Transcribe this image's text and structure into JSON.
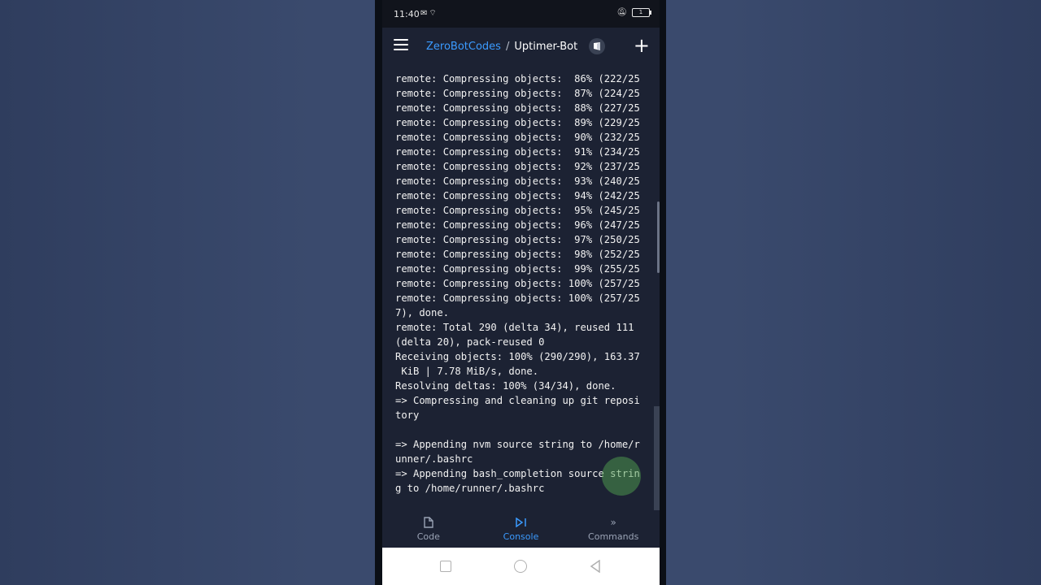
{
  "status_bar": {
    "time": "11:40",
    "battery_level": "1"
  },
  "header": {
    "owner": "ZeroBotCodes",
    "separator": "/",
    "repl_name": "Uptimer-Bot"
  },
  "console": {
    "lines": [
      "remote: Compressing objects:  86% (222/25",
      "remote: Compressing objects:  87% (224/25",
      "remote: Compressing objects:  88% (227/25",
      "remote: Compressing objects:  89% (229/25",
      "remote: Compressing objects:  90% (232/25",
      "remote: Compressing objects:  91% (234/25",
      "remote: Compressing objects:  92% (237/25",
      "remote: Compressing objects:  93% (240/25",
      "remote: Compressing objects:  94% (242/25",
      "remote: Compressing objects:  95% (245/25",
      "remote: Compressing objects:  96% (247/25",
      "remote: Compressing objects:  97% (250/25",
      "remote: Compressing objects:  98% (252/25",
      "remote: Compressing objects:  99% (255/25",
      "remote: Compressing objects: 100% (257/25",
      "remote: Compressing objects: 100% (257/25",
      "7), done.",
      "remote: Total 290 (delta 34), reused 111",
      "(delta 20), pack-reused 0",
      "Receiving objects: 100% (290/290), 163.37",
      " KiB | 7.78 MiB/s, done.",
      "Resolving deltas: 100% (34/34), done.",
      "=> Compressing and cleaning up git reposi",
      "tory",
      "",
      "=> Appending nvm source string to /home/r",
      "unner/.bashrc",
      "=> Appending bash_completion source strin",
      "g to /home/runner/.bashrc"
    ]
  },
  "bottom_nav": {
    "items": [
      {
        "label": "Code",
        "icon": "file-icon"
      },
      {
        "label": "Console",
        "icon": "console-icon"
      },
      {
        "label": "Commands",
        "icon": "chevrons-right-icon"
      }
    ],
    "active_index": 1
  }
}
